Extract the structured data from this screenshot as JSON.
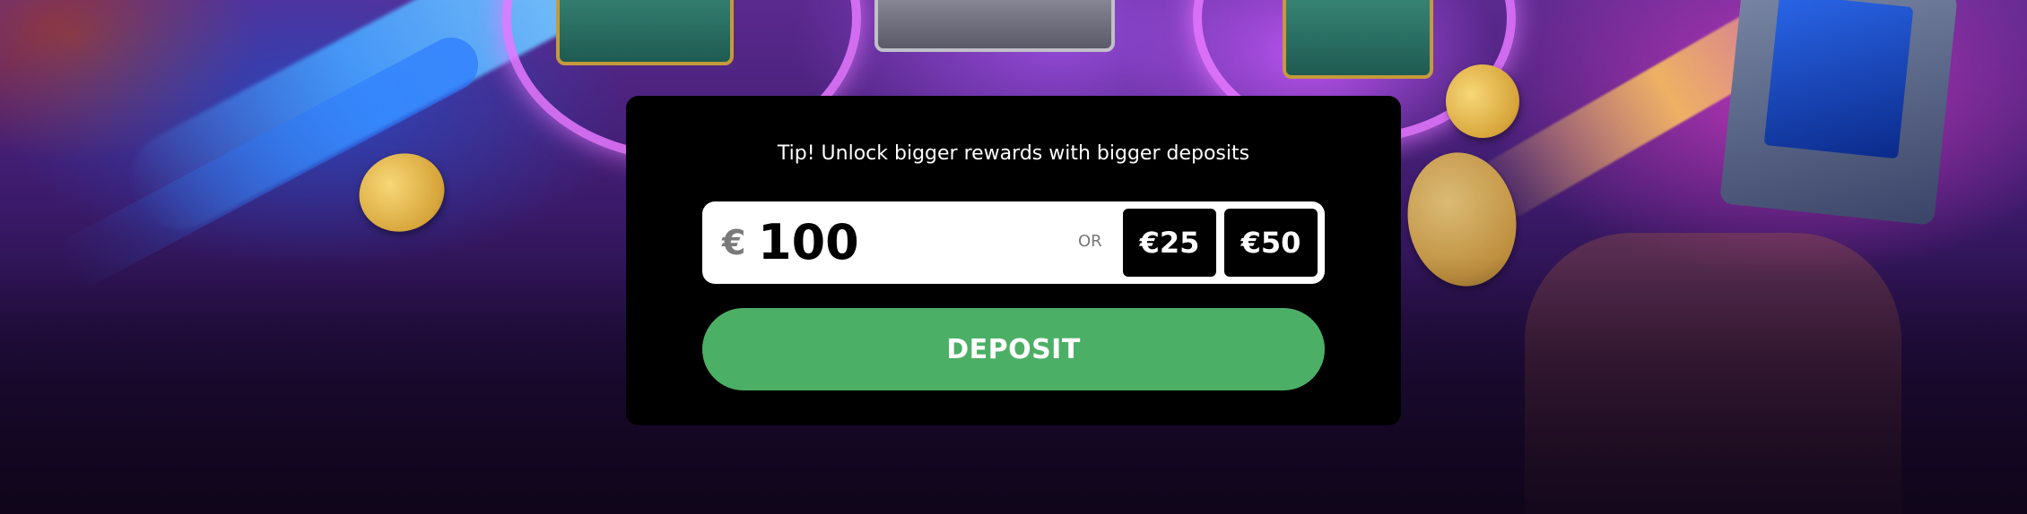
{
  "deposit_panel": {
    "tip": "Tip! Unlock bigger rewards with bigger deposits",
    "currency_symbol": "€",
    "amount_value": "100",
    "or_label": "OR",
    "quick_amounts": [
      "€25",
      "€50"
    ],
    "deposit_label": "DEPOSIT"
  },
  "colors": {
    "panel_background": "#000000",
    "deposit_button": "#4caf66",
    "input_background": "#ffffff"
  }
}
